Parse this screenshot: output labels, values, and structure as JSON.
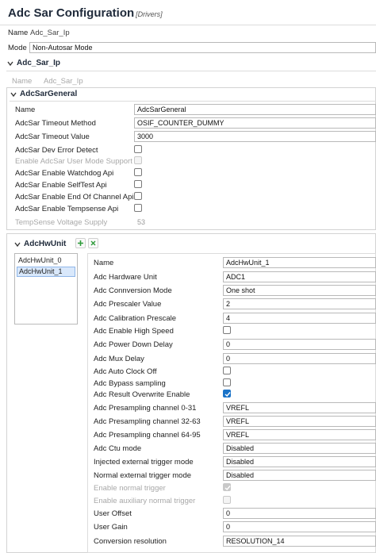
{
  "header": {
    "title": "Adc Sar Configuration",
    "subtitle": "[Drivers]"
  },
  "top": {
    "name_label": "Name",
    "name_value": "Adc_Sar_Ip",
    "mode_label": "Mode",
    "mode_value": "Non-Autosar Mode"
  },
  "sections": {
    "adc_sar_ip": "Adc_Sar_Ip",
    "adc_sar_general": "AdcSarGeneral",
    "adc_hw_unit": "AdcHwUnit"
  },
  "ip": {
    "name_label": "Name",
    "name_value": "Adc_Sar_Ip"
  },
  "general": {
    "name_label": "Name",
    "name_value": "AdcSarGeneral",
    "timeout_method_label": "AdcSar Timeout Method",
    "timeout_method_value": "OSIF_COUNTER_DUMMY",
    "timeout_value_label": "AdcSar Timeout Value",
    "timeout_value_value": "3000",
    "dev_error_label": "AdcSar Dev Error Detect",
    "user_mode_label": "Enable AdcSar User Mode Support",
    "watchdog_label": "AdcSar Enable Watchdog Api",
    "selftest_label": "AdcSar Enable SelfTest Api",
    "eoc_label": "AdcSar Enable End Of Channel Api",
    "tempsense_label": "AdcSar Enable Tempsense Api",
    "tempsense_voltage_label": "TempSense Voltage Supply",
    "tempsense_voltage_value": "53"
  },
  "hwunit_list": [
    "AdcHwUnit_0",
    "AdcHwUnit_1"
  ],
  "hw": {
    "name_label": "Name",
    "name_value": "AdcHwUnit_1",
    "hw_unit_label": "Adc Hardware Unit",
    "hw_unit_value": "ADC1",
    "conv_mode_label": "Adc Connversion Mode",
    "conv_mode_value": "One shot",
    "prescaler_label": "Adc Prescaler Value",
    "prescaler_value": "2",
    "cal_prescale_label": "Adc Calibration Prescale",
    "cal_prescale_value": "4",
    "high_speed_label": "Adc Enable High Speed",
    "power_down_label": "Adc Power Down Delay",
    "power_down_value": "0",
    "mux_delay_label": "Adc Mux Delay",
    "mux_delay_value": "0",
    "auto_clock_label": "Adc Auto Clock Off",
    "bypass_label": "Adc Bypass sampling",
    "overwrite_label": "Adc Result Overwrite Enable",
    "presamp0_label": "Adc Presampling channel 0-31",
    "presamp0_value": "VREFL",
    "presamp32_label": "Adc Presampling channel 32-63",
    "presamp32_value": "VREFL",
    "presamp64_label": "Adc Presampling channel 64-95",
    "presamp64_value": "VREFL",
    "ctu_label": "Adc Ctu mode",
    "ctu_value": "Disabled",
    "injected_label": "Injected external trigger mode",
    "injected_value": "Disabled",
    "normal_label": "Normal external trigger mode",
    "normal_value": "Disabled",
    "en_normal_label": "Enable normal trigger",
    "en_aux_label": "Enable auxiliary normal trigger",
    "user_offset_label": "User Offset",
    "user_offset_value": "0",
    "user_gain_label": "User Gain",
    "user_gain_value": "0",
    "resolution_label": "Conversion resolution",
    "resolution_value": "RESOLUTION_14"
  },
  "checkbox_states": {
    "dev_error": false,
    "user_mode": false,
    "watchdog": false,
    "selftest": false,
    "eoc": false,
    "tempsense": false,
    "high_speed": false,
    "auto_clock": false,
    "bypass": false,
    "overwrite": true,
    "en_normal": true,
    "en_aux": false
  },
  "icons": {
    "add": "plus-icon",
    "remove": "close-icon",
    "collapse": "chevron-down-icon"
  },
  "colors": {
    "accent": "#1a73c8",
    "checkbox_checked": "#1a73c8",
    "add_icon": "#2e9b3a"
  }
}
